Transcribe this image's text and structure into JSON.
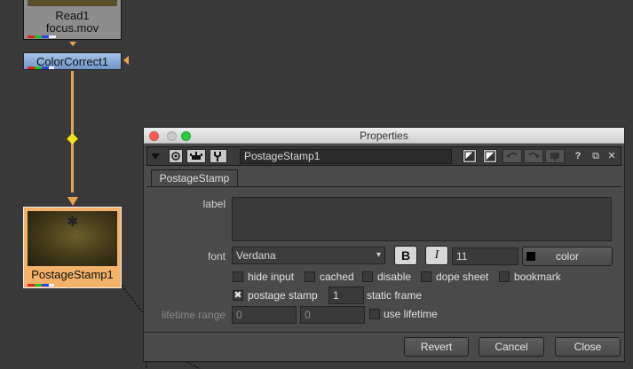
{
  "nodes": {
    "read": {
      "line1": "Read1",
      "line2": "focus.mov"
    },
    "color_correct": {
      "label": "ColorCorrect1"
    },
    "postage_stamp": {
      "label": "PostageStamp1"
    }
  },
  "properties": {
    "window_title": "Properties",
    "node_name": "PostageStamp1",
    "toolbar_icons": [
      "triangle-down-icon",
      "circle-icon",
      "node-icon",
      "wrench-icon",
      "color-swatch-icon",
      "color-swatch-icon",
      "undo-icon",
      "redo-icon",
      "revert-icon"
    ],
    "help_label": "?",
    "float_label": "⧉",
    "close_label": "✕",
    "tab_label": "PostageStamp",
    "label_knob": {
      "label": "label",
      "value": ""
    },
    "font_knob": {
      "label": "font",
      "value": "Verdana",
      "bold_label": "B",
      "italic_label": "I",
      "size": "11",
      "color_label": "color"
    },
    "checkboxes": [
      {
        "label": "hide input",
        "checked": false
      },
      {
        "label": "cached",
        "checked": false
      },
      {
        "label": "disable",
        "checked": false
      },
      {
        "label": "dope sheet",
        "checked": false
      },
      {
        "label": "bookmark",
        "checked": false
      }
    ],
    "postage_stamp": {
      "label": "postage stamp",
      "checked": true,
      "frame": "1",
      "static_label": "static frame"
    },
    "lifetime": {
      "label": "lifetime range",
      "start": "0",
      "end": "0",
      "use_label": "use lifetime"
    },
    "buttons": {
      "revert": "Revert",
      "cancel": "Cancel",
      "close": "Close"
    }
  },
  "colors": {
    "wire": "#e8a550",
    "node_selected": "#f3b269",
    "color_correct_node": "#8bacd8"
  }
}
